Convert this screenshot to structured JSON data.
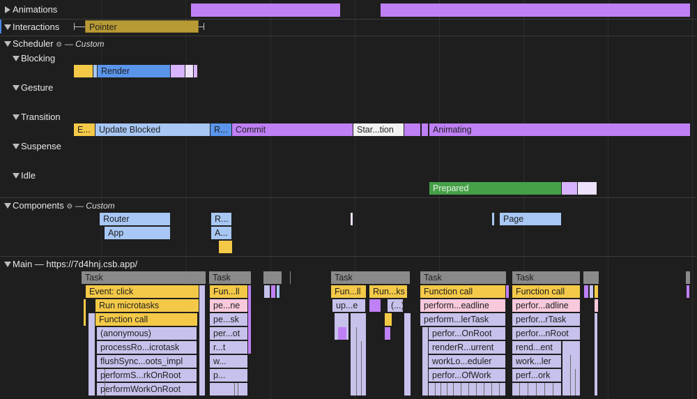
{
  "tracks": {
    "animations": "Animations",
    "interactions": "Interactions",
    "scheduler": "Scheduler",
    "scheduler_tag": "— Custom",
    "blocking": "Blocking",
    "gesture": "Gesture",
    "transition": "Transition",
    "suspense": "Suspense",
    "idle": "Idle",
    "components": "Components",
    "components_tag": "— Custom",
    "main": "Main — https://7d4hnj.csb.app/"
  },
  "icons": {
    "gear": "⚙"
  },
  "interactions": {
    "pointer": "Pointer"
  },
  "blocking": {
    "render": "Render"
  },
  "transition": {
    "e": "E...",
    "update_blocked": "Update Blocked",
    "r": "R...",
    "commit": "Commit",
    "start_transition": "Star...tion",
    "animating": "Animating"
  },
  "idle": {
    "prepared": "Prepared"
  },
  "components": {
    "router": "Router",
    "app": "App",
    "r_short": "R...",
    "a_short": "A...",
    "page": "Page"
  },
  "main": {
    "task": "Task",
    "col1": [
      "Event: click",
      "Run microtasks",
      "Function call",
      "(anonymous)",
      "processRo...icrotask",
      "flushSync...oots_impl",
      "performS...rkOnRoot",
      "performWorkOnRoot"
    ],
    "col2": [
      "Fun...ll",
      "pe...ne",
      "pe...sk",
      "per...ot",
      "r...t",
      "w...",
      "p..."
    ],
    "col3": [
      "Fun...ll",
      "up...e"
    ],
    "col4": [
      "Run...ks",
      "(...)"
    ],
    "col5": [
      "Function call",
      "perform...eadline",
      "perform...lerTask",
      "perfor...OnRoot",
      "renderR...urrent",
      "workLo...eduler",
      "perfor...OfWork"
    ],
    "col6": [
      "Function call",
      "perfor...adline",
      "perfor...rTask",
      "perfor...nRoot",
      "rend...ent",
      "work...ler",
      "perf...ork"
    ]
  },
  "colors": {
    "background": "#1e1e1e",
    "purple": "#bf80f6",
    "blue": "#5a95ec",
    "light_blue": "#a8c7f4",
    "yellow": "#f4c948",
    "green": "#45a047",
    "olive": "#b89a35",
    "lavender": "#c7c2ec",
    "pink": "#f8c9dc",
    "task_gray": "#8a8a8a"
  }
}
